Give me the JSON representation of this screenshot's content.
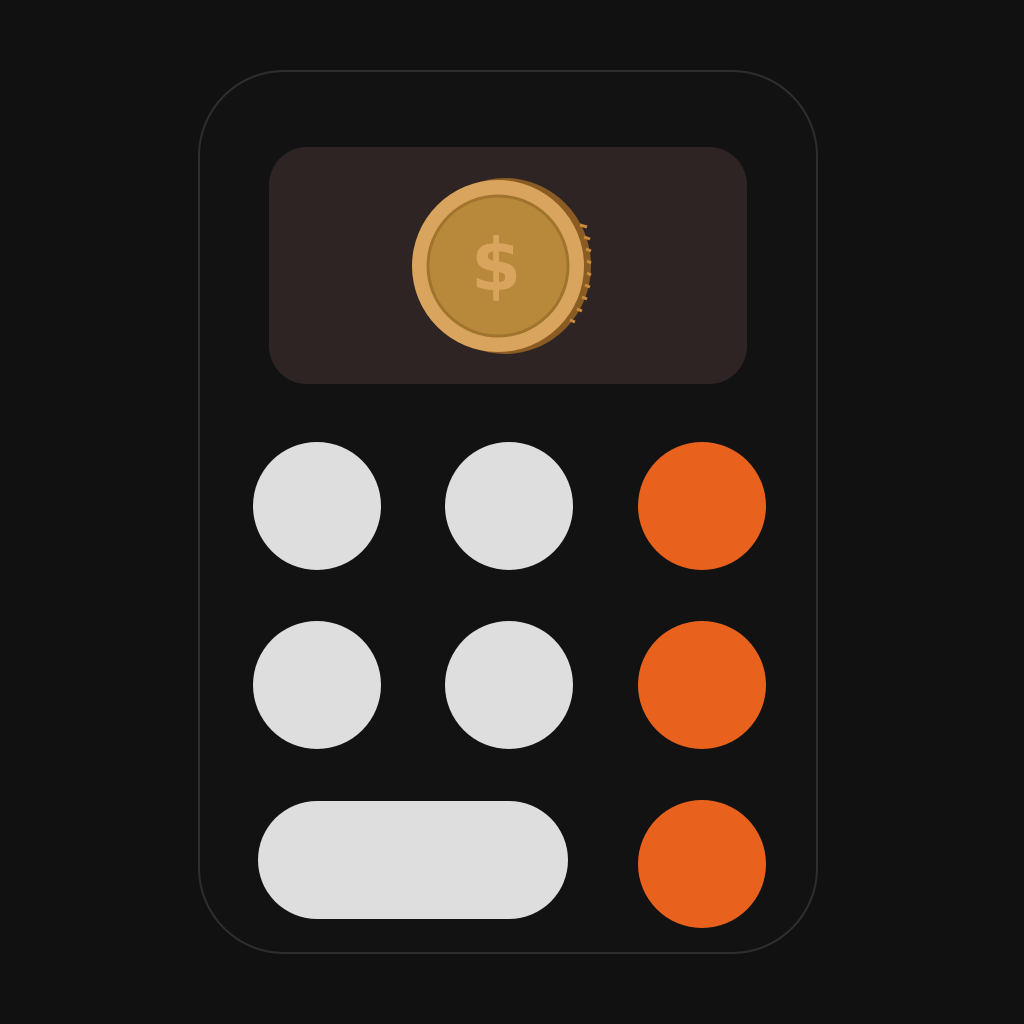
{
  "icon": {
    "name": "calculator-coin-icon",
    "coin_symbol": "$",
    "colors": {
      "background": "#111111",
      "body": "#121212",
      "body_border": "#2e2e2e",
      "display": "#2e2424",
      "key_light": "#dedede",
      "key_orange": "#e8621e",
      "coin_face": "#b8893a",
      "coin_rim": "#d9a55e",
      "coin_edge": "#8a5c23"
    },
    "keys": [
      {
        "name": "key-light-1",
        "color": "light"
      },
      {
        "name": "key-light-2",
        "color": "light"
      },
      {
        "name": "key-orange-1",
        "color": "orange"
      },
      {
        "name": "key-light-3",
        "color": "light"
      },
      {
        "name": "key-light-4",
        "color": "light"
      },
      {
        "name": "key-orange-2",
        "color": "orange"
      },
      {
        "name": "key-light-wide",
        "color": "light"
      },
      {
        "name": "key-orange-3",
        "color": "orange"
      }
    ]
  }
}
